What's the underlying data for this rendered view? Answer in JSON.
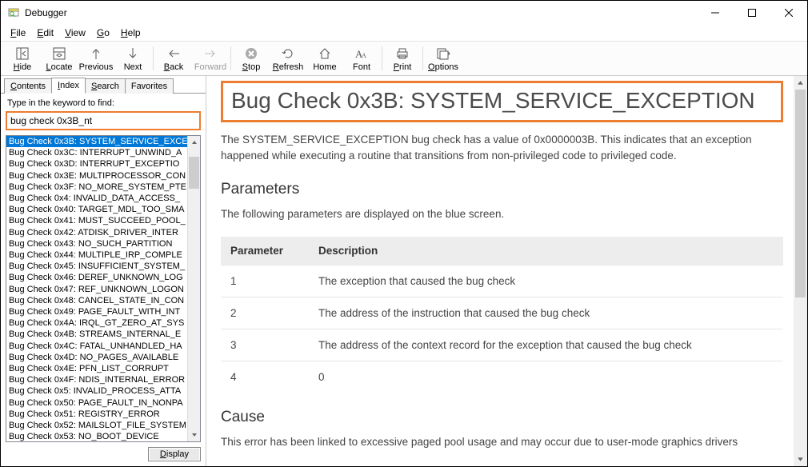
{
  "window": {
    "title": "Debugger"
  },
  "menu": {
    "items": [
      "File",
      "Edit",
      "View",
      "Go",
      "Help"
    ]
  },
  "toolbar": {
    "hide": "Hide",
    "locate": "Locate",
    "previous": "Previous",
    "next": "Next",
    "back": "Back",
    "forward": "Forward",
    "stop": "Stop",
    "refresh": "Refresh",
    "home": "Home",
    "font": "Font",
    "print": "Print",
    "options": "Options"
  },
  "tabs": {
    "contents": "Contents",
    "index": "Index",
    "search": "Search",
    "favorites": "Favorites"
  },
  "sidebar": {
    "search_label": "Type in the keyword to find:",
    "search_value": "bug check 0x3B_nt",
    "display_button": "Display",
    "items": [
      "Bug Check 0x3B: SYSTEM_SERVICE_EXCE",
      "Bug Check 0x3C: INTERRUPT_UNWIND_A",
      "Bug Check 0x3D: INTERRUPT_EXCEPTIO",
      "Bug Check 0x3E: MULTIPROCESSOR_CON",
      "Bug Check 0x3F: NO_MORE_SYSTEM_PTE",
      "Bug Check 0x4: INVALID_DATA_ACCESS_",
      "Bug Check 0x40: TARGET_MDL_TOO_SMA",
      "Bug Check 0x41: MUST_SUCCEED_POOL_",
      "Bug Check 0x42: ATDISK_DRIVER_INTER",
      "Bug Check 0x43: NO_SUCH_PARTITION",
      "Bug Check 0x44: MULTIPLE_IRP_COMPLE",
      "Bug Check 0x45: INSUFFICIENT_SYSTEM_",
      "Bug Check 0x46: DEREF_UNKNOWN_LOG",
      "Bug Check 0x47: REF_UNKNOWN_LOGON",
      "Bug Check 0x48: CANCEL_STATE_IN_CON",
      "Bug Check 0x49: PAGE_FAULT_WITH_INT",
      "Bug Check 0x4A: IRQL_GT_ZERO_AT_SYS",
      "Bug Check 0x4B: STREAMS_INTERNAL_E",
      "Bug Check 0x4C: FATAL_UNHANDLED_HA",
      "Bug Check 0x4D: NO_PAGES_AVAILABLE",
      "Bug Check 0x4E: PFN_LIST_CORRUPT",
      "Bug Check 0x4F: NDIS_INTERNAL_ERROR",
      "Bug Check 0x5: INVALID_PROCESS_ATTA",
      "Bug Check 0x50: PAGE_FAULT_IN_NONPA",
      "Bug Check 0x51: REGISTRY_ERROR",
      "Bug Check 0x52: MAILSLOT_FILE_SYSTEM",
      "Bug Check 0x53: NO_BOOT_DEVICE"
    ]
  },
  "content": {
    "title": "Bug Check 0x3B: SYSTEM_SERVICE_EXCEPTION",
    "intro": "The SYSTEM_SERVICE_EXCEPTION bug check has a value of 0x0000003B. This indicates that an exception happened while executing a routine that transitions from non-privileged code to privileged code.",
    "params_heading": "Parameters",
    "params_intro": "The following parameters are displayed on the blue screen.",
    "table": {
      "col1": "Parameter",
      "col2": "Description",
      "rows": [
        {
          "p": "1",
          "d": "The exception that caused the bug check"
        },
        {
          "p": "2",
          "d": "The address of the instruction that caused the bug check"
        },
        {
          "p": "3",
          "d": "The address of the context record for the exception that caused the bug check"
        },
        {
          "p": "4",
          "d": "0"
        }
      ]
    },
    "cause_heading": "Cause",
    "cause_text": "This error has been linked to excessive paged pool usage and may occur due to user-mode graphics drivers"
  }
}
